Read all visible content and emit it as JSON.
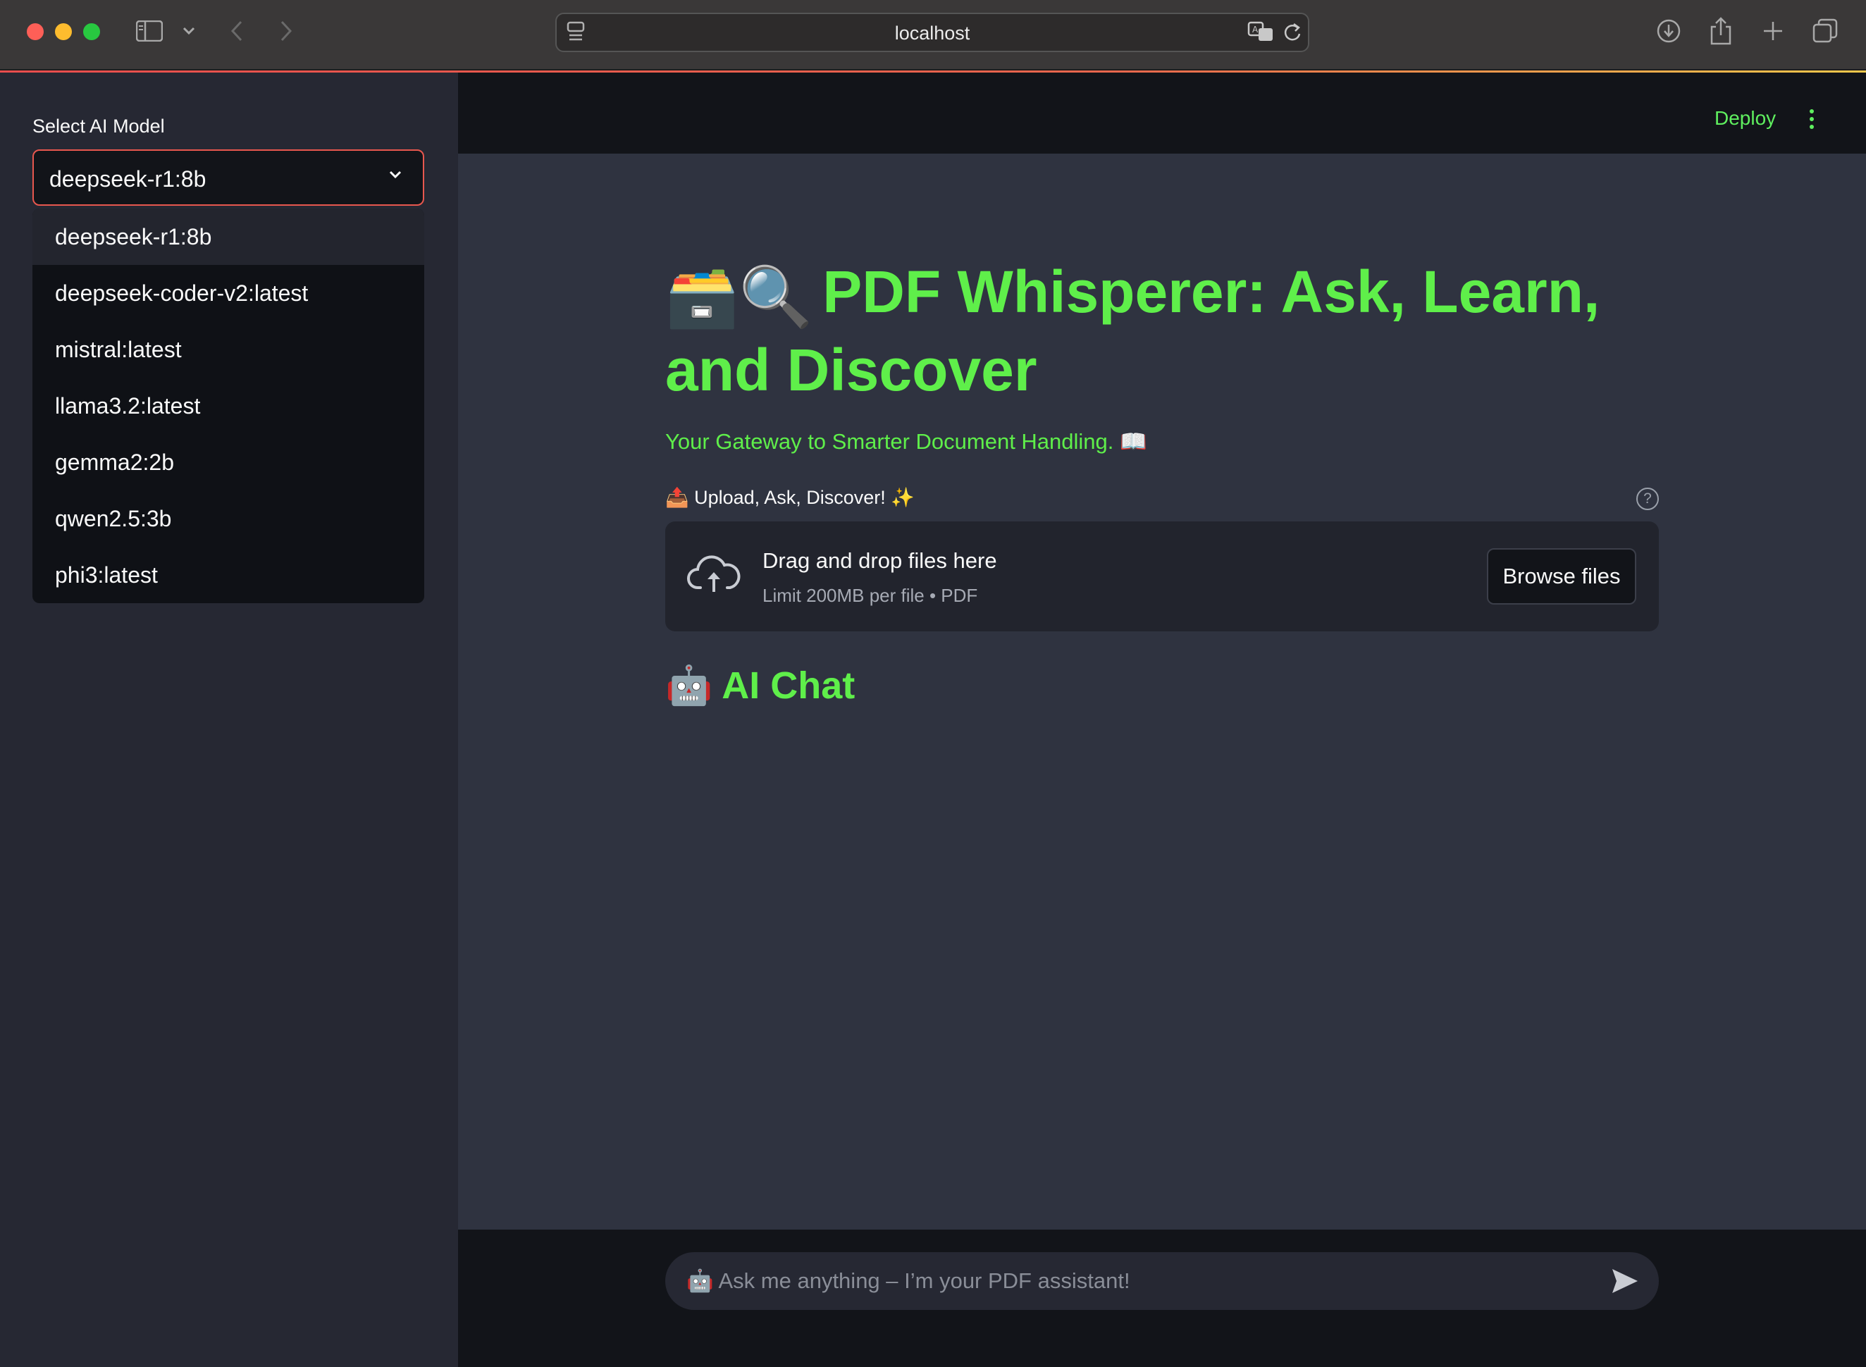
{
  "browser": {
    "url": "localhost",
    "icons": [
      "sidebar-icon",
      "chevron-down-icon",
      "back-icon",
      "forward-icon",
      "page-icon",
      "translate-icon",
      "reload-icon",
      "download-icon",
      "share-icon",
      "new-tab-icon",
      "tabs-overview-icon"
    ]
  },
  "sidebar": {
    "select_label": "Select AI Model",
    "selected_model": "deepseek-r1:8b",
    "options": [
      {
        "label": "deepseek-r1:8b"
      },
      {
        "label": "deepseek-coder-v2:latest"
      },
      {
        "label": "mistral:latest"
      },
      {
        "label": "llama3.2:latest"
      },
      {
        "label": "gemma2:2b"
      },
      {
        "label": "qwen2.5:3b"
      },
      {
        "label": "phi3:latest"
      }
    ]
  },
  "header": {
    "deploy_label": "Deploy"
  },
  "main": {
    "title_emoji": "🗃️🔍",
    "title": "PDF Whisperer: Ask, Learn, and Discover",
    "subtitle": "Your Gateway to Smarter Document Handling. 📖",
    "uploader_label": "📤 Upload, Ask, Discover! ✨",
    "dropzone_title": "Drag and drop files here",
    "dropzone_sub": "Limit 200MB per file • PDF",
    "browse_label": "Browse files",
    "chat_title": "🤖 AI Chat",
    "chat_placeholder": "🤖 Ask me anything – I’m your PDF assistant!"
  },
  "colors": {
    "accent_green": "#5fef4a",
    "select_border": "#e8574e",
    "sidebar_bg": "#262833",
    "main_bg": "#2f3340"
  }
}
